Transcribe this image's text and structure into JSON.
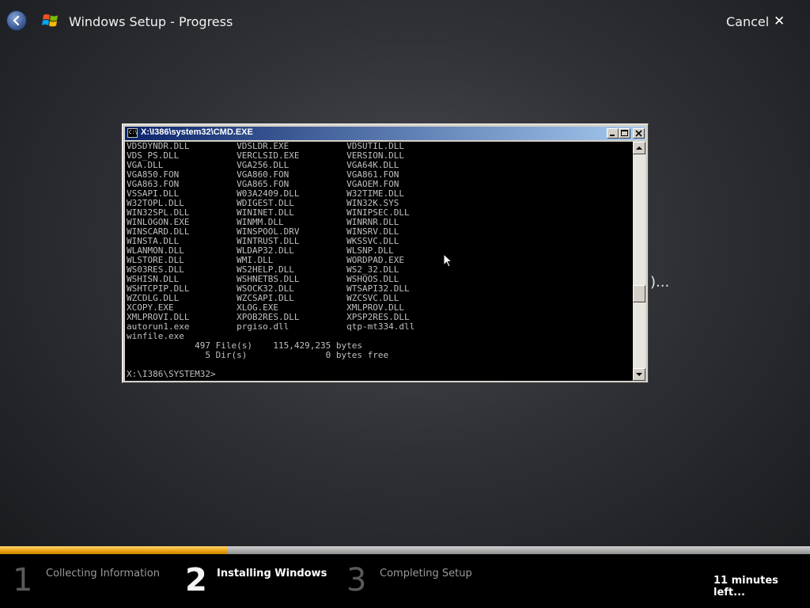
{
  "header": {
    "title": "Windows Setup - Progress",
    "cancel_label": "Cancel",
    "close_glyph": "✕",
    "peek_text": ")...",
    "back_icon": "back-arrow-icon",
    "logo_icon": "windows-flag-icon"
  },
  "cmd_window": {
    "title": "X:\\I386\\system32\\CMD.EXE",
    "icon_label": "C:\\",
    "lines": [
      "VDSDYNDR.DLL         VDSLDR.EXE           VDSUTIL.DLL",
      "VDS_PS.DLL           VERCLSID.EXE         VERSION.DLL",
      "VGA.DLL              VGA256.DLL           VGA64K.DLL",
      "VGA850.FON           VGA860.FON           VGA861.FON",
      "VGA863.FON           VGA865.FON           VGAOEM.FON",
      "VSSAPI.DLL           W03A2409.DLL         W32TIME.DLL",
      "W32TOPL.DLL          WDIGEST.DLL          WIN32K.SYS",
      "WIN32SPL.DLL         WININET.DLL          WINIPSEC.DLL",
      "WINLOGON.EXE         WINMM.DLL            WINRNR.DLL",
      "WINSCARD.DLL         WINSPOOL.DRV         WINSRV.DLL",
      "WINSTA.DLL           WINTRUST.DLL         WKSSVC.DLL",
      "WLANMON.DLL          WLDAP32.DLL          WLSNP.DLL",
      "WLSTORE.DLL          WMI.DLL              WORDPAD.EXE",
      "WS03RES.DLL          WS2HELP.DLL          WS2_32.DLL",
      "WSHISN.DLL           WSHNETBS.DLL         WSHQOS.DLL",
      "WSHTCPIP.DLL         WSOCK32.DLL          WTSAPI32.DLL",
      "WZCDLG.DLL           WZCSAPI.DLL          WZCSVC.DLL",
      "XCOPY.EXE            XLOG.EXE             XMLPROV.DLL",
      "XMLPROVI.DLL         XPOB2RES.DLL         XPSP2RES.DLL",
      "autorun1.exe         prgiso.dll           qtp-mt334.dll",
      "winfile.exe",
      "             497 File(s)    115,429,235 bytes",
      "               5 Dir(s)               0 bytes free",
      "",
      "X:\\I386\\SYSTEM32>"
    ]
  },
  "progress": {
    "fraction": 0.28,
    "steps": [
      {
        "number": "1",
        "label": "Collecting Information",
        "active": false
      },
      {
        "number": "2",
        "label": "Installing Windows",
        "active": true
      },
      {
        "number": "3",
        "label": "Completing Setup",
        "active": false
      }
    ],
    "time_left": "11 minutes left..."
  },
  "colors": {
    "progress_fill": "#e8a010",
    "titlebar_start": "#0a246a",
    "titlebar_end": "#a6caf0",
    "console_text": "#c0c0c0"
  }
}
